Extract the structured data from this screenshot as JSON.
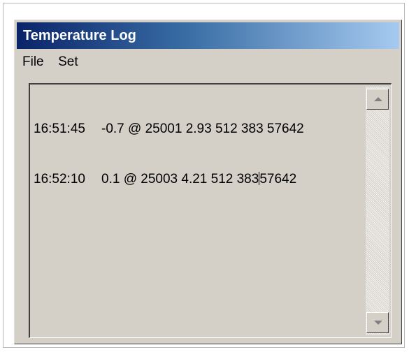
{
  "window": {
    "title": "Temperature Log"
  },
  "menu": {
    "items": [
      "File",
      "Set"
    ]
  },
  "log": {
    "lines": [
      {
        "time": "16:51:45",
        "data": "-0.7 @ 25001 2.93 512 383 57642"
      },
      {
        "time": "16:52:10",
        "data_before_caret": "0.1 @ 25003 4.21 512 383",
        "data_after_caret": "57642"
      }
    ]
  },
  "colors": {
    "titlebar_start": "#0a246a",
    "titlebar_end": "#a6caf0",
    "window_face": "#d4d0c8"
  },
  "icons": {
    "scroll_up": "scroll-up-arrow-icon",
    "scroll_down": "scroll-down-arrow-icon"
  }
}
